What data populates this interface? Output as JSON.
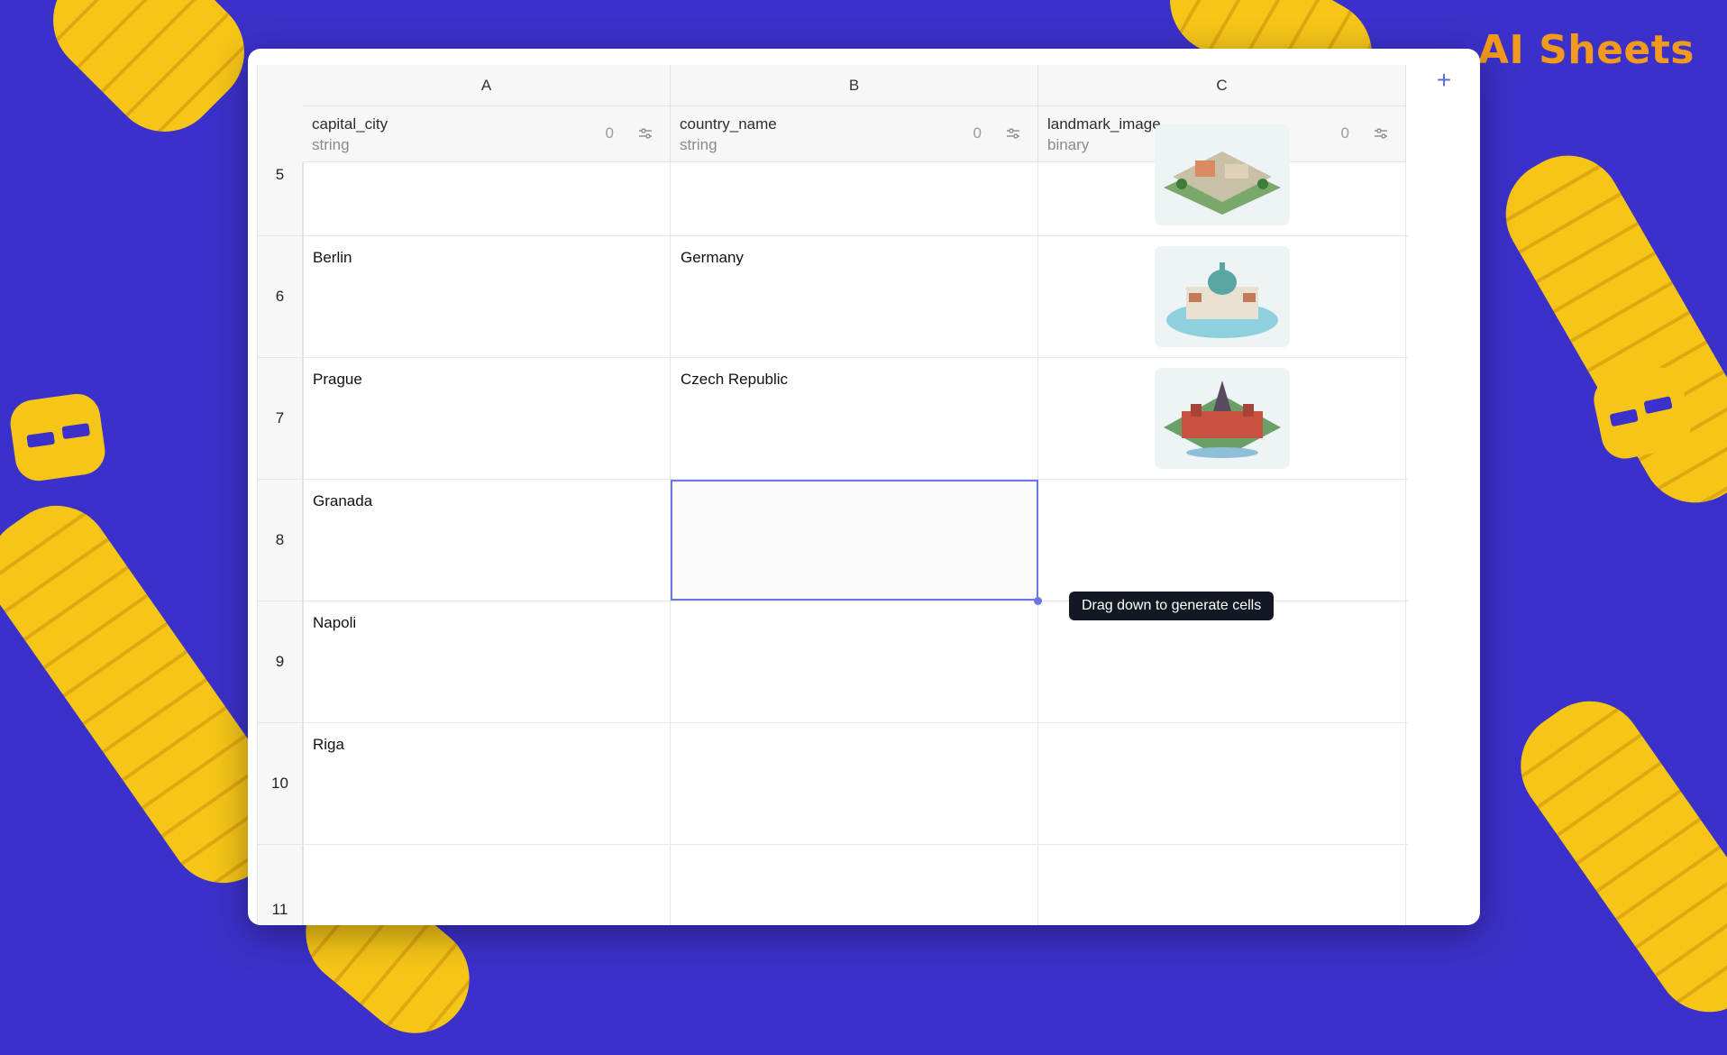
{
  "brand": "AI Sheets",
  "columns": [
    {
      "letter": "A",
      "field": "capital_city",
      "type": "string",
      "count": "0"
    },
    {
      "letter": "B",
      "field": "country_name",
      "type": "string",
      "count": "0"
    },
    {
      "letter": "C",
      "field": "landmark_image",
      "type": "binary",
      "count": "0"
    }
  ],
  "rows": [
    {
      "num": "5",
      "a": "",
      "b": ""
    },
    {
      "num": "6",
      "a": "Berlin",
      "b": "Germany"
    },
    {
      "num": "7",
      "a": "Prague",
      "b": "Czech Republic"
    },
    {
      "num": "8",
      "a": "Granada",
      "b": ""
    },
    {
      "num": "9",
      "a": "Napoli",
      "b": ""
    },
    {
      "num": "10",
      "a": "Riga",
      "b": ""
    },
    {
      "num": "11",
      "a": "",
      "b": ""
    }
  ],
  "tooltip": "Drag down to generate cells",
  "add_column_label": "+",
  "colors": {
    "accent": "#6a77e0",
    "background": "#3b30c9",
    "brand": "#f39a1c",
    "rope": "#f5c518"
  }
}
